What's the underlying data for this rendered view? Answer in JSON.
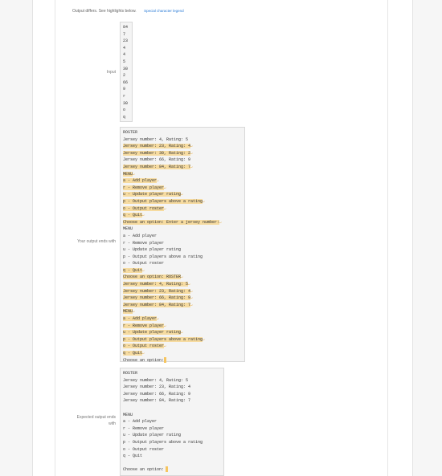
{
  "header": {
    "message": "Output differs. See highlights below.",
    "legend_link": "Special character legend"
  },
  "labels": {
    "input": "Input",
    "your_output": "Your output ends with",
    "expected_output": "Expected output ends with"
  },
  "input_lines": [
    "84",
    "7",
    "23",
    "4",
    "4",
    "5",
    "30",
    "2",
    "66",
    "9",
    "r",
    "30",
    "o",
    "q"
  ],
  "your_output": [
    {
      "text": "ROSTER",
      "hl": false
    },
    {
      "text": "Jersey number: 4, Rating: 5",
      "hl": false
    },
    {
      "text": "Jersey number: 23, Rating: 4",
      "hl": true
    },
    {
      "text": "Jersey number: 30, Rating: 2",
      "hl": true
    },
    {
      "text": "Jersey number: 66, Rating: 9",
      "hl": false
    },
    {
      "text": "Jersey number: 84, Rating: 7",
      "hl": true
    },
    {
      "text": "MENU",
      "hl": true
    },
    {
      "text": "a - Add player",
      "hl": true
    },
    {
      "text": "r - Remove player",
      "hl": true
    },
    {
      "text": "u - Update player rating",
      "hl": true
    },
    {
      "text": "p - Output players above a rating",
      "hl": true
    },
    {
      "text": "o - Output roster",
      "hl": true
    },
    {
      "text": "q - Quit",
      "hl": true
    },
    {
      "text": "Choose an option: Enter a jersey number:",
      "hl": true
    },
    {
      "text": "MENU",
      "hl": false
    },
    {
      "text": "a - Add player",
      "hl": false
    },
    {
      "text": "r - Remove player",
      "hl": false
    },
    {
      "text": "u - Update player rating",
      "hl": false
    },
    {
      "text": "p - Output players above a rating",
      "hl": false
    },
    {
      "text": "o - Output roster",
      "hl": false
    },
    {
      "text": "q - Quit",
      "hl": true
    },
    {
      "text": "Choose an option: ROSTER",
      "hl": true
    },
    {
      "text": "Jersey number: 4, Rating: 5",
      "hl": true
    },
    {
      "text": "Jersey number: 23, Rating: 4",
      "hl": true
    },
    {
      "text": "Jersey number: 66, Rating: 9",
      "hl": true
    },
    {
      "text": "Jersey number: 84, Rating: 7",
      "hl": true
    },
    {
      "text": "MENU",
      "hl": true
    },
    {
      "text": "a - Add player",
      "hl": true
    },
    {
      "text": "r - Remove player",
      "hl": true
    },
    {
      "text": "u - Update player rating",
      "hl": true
    },
    {
      "text": "p - Output players above a rating",
      "hl": true
    },
    {
      "text": "o - Output roster",
      "hl": true
    },
    {
      "text": "q - Quit",
      "hl": true
    },
    {
      "text": "Choose an option:",
      "hl": false
    }
  ],
  "expected_output": [
    "ROSTER",
    "Jersey number: 4, Rating: 5",
    "Jersey number: 23, Rating: 4",
    "Jersey number: 66, Rating: 9",
    "Jersey number: 84, Rating: 7",
    "",
    "MENU",
    "a - Add player",
    "r - Remove player",
    "u - Update player rating",
    "p - Output players above a rating",
    "o - Output roster",
    "q - Quit",
    "",
    "Choose an option:"
  ],
  "colors": {
    "highlight": "#f6dba0",
    "link": "#2b7bd6"
  }
}
